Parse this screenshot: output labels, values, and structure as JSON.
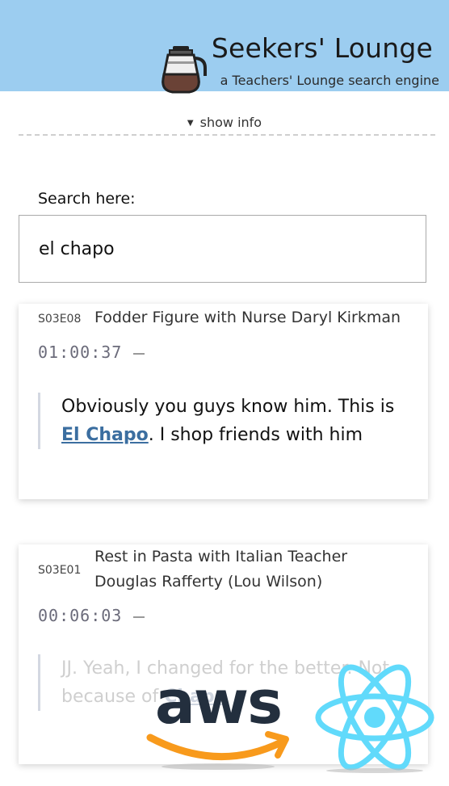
{
  "header": {
    "title": "Seekers' Lounge",
    "subtitle": "a Teachers' Lounge search engine",
    "logo_icon": "coffee-pot-icon",
    "background": "#9ccdf0"
  },
  "info_toggle": {
    "icon": "triangle-down-icon",
    "label": "show info"
  },
  "search": {
    "label": "Search here:",
    "value": "el chapo"
  },
  "results": [
    {
      "episode": "S03E08",
      "title": "Fodder Figure with Nurse Daryl Kirkman",
      "timestamp": "01:00:37",
      "quote_before": "Obviously you guys know him. This is ",
      "quote_link": "El Chapo",
      "quote_after": ". I shop friends with him"
    },
    {
      "episode": "S03E01",
      "title": "Rest in Pasta with Italian Teacher Douglas Rafferty (Lou Wilson)",
      "timestamp": "00:06:03",
      "quote_before": "JJ. Yeah, I changed for the better. Not because of ",
      "quote_link": "Chapo",
      "quote_after": ""
    }
  ],
  "overlay": {
    "aws_logo_text": "aws",
    "react_logo": "react-logo-icon"
  },
  "colors": {
    "link": "#3b6ea0",
    "aws_orange": "#f89a1c",
    "react_blue": "#61dafb"
  }
}
